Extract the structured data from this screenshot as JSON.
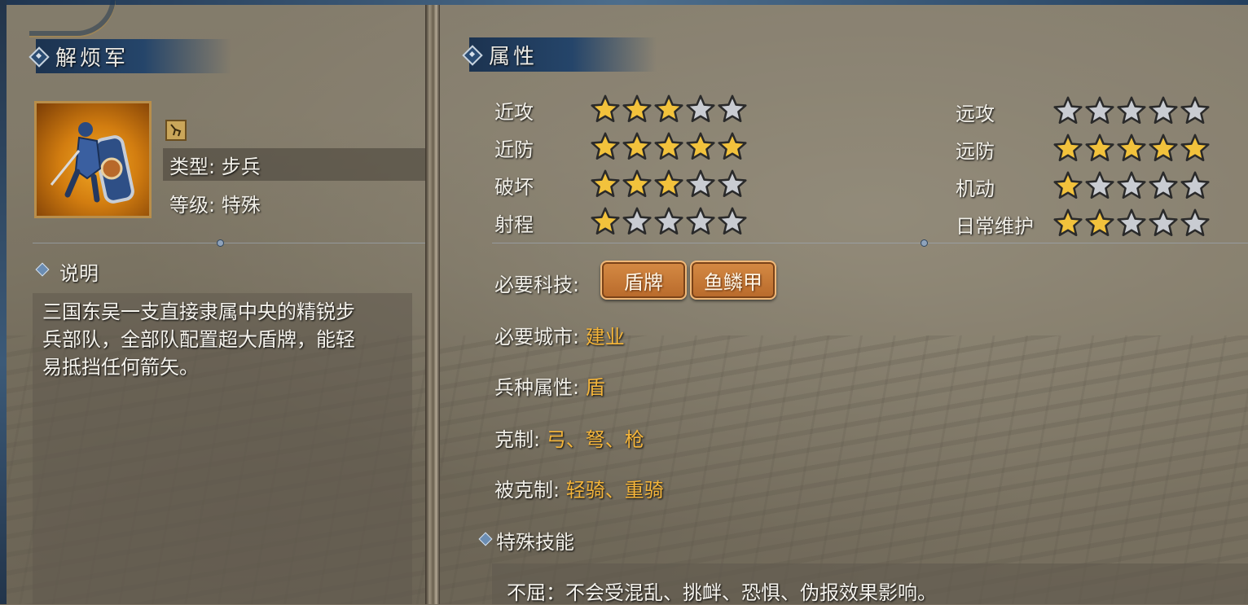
{
  "colors": {
    "accent_gold": "#f3b43a",
    "header_blue": "#1c3350",
    "tech_button": "#c77a36",
    "star_filled": "#f2c23c",
    "star_empty": "#c9ccd2"
  },
  "unit": {
    "name": "解烦军",
    "type_label": "类型: 步兵",
    "level_label": "等级: 特殊",
    "portrait_icon": "shield-infantry-portrait",
    "type_badge_icon": "infantry-class-icon",
    "description_heading": "说明",
    "description": "三国东吴一支直接隶属中央的精锐步兵部队，全部队配置超大盾牌，能轻易抵挡任何箭矢。"
  },
  "attributes": {
    "title": "属性",
    "left": [
      {
        "label": "近攻",
        "rating": 3
      },
      {
        "label": "近防",
        "rating": 5
      },
      {
        "label": "破坏",
        "rating": 3
      },
      {
        "label": "射程",
        "rating": 1
      }
    ],
    "right": [
      {
        "label": "远攻",
        "rating": 0
      },
      {
        "label": "远防",
        "rating": 5
      },
      {
        "label": "机动",
        "rating": 1
      },
      {
        "label": "日常维护",
        "rating": 2
      }
    ],
    "max_rating": 5
  },
  "requirements": {
    "tech_label": "必要科技: ",
    "tech_items": [
      "盾牌",
      "鱼鳞甲"
    ],
    "city_label": "必要城市: ",
    "city_value": "建业",
    "trait_label": "兵种属性: ",
    "trait_value": "盾",
    "counters_label": "克制: ",
    "counters_value": "弓、弩、枪",
    "countered_by_label": "被克制: ",
    "countered_by_value": "轻骑、重骑"
  },
  "special_skill": {
    "heading": "特殊技能",
    "text": "不屈：不会受混乱、挑衅、恐惧、伪报效果影响。"
  }
}
